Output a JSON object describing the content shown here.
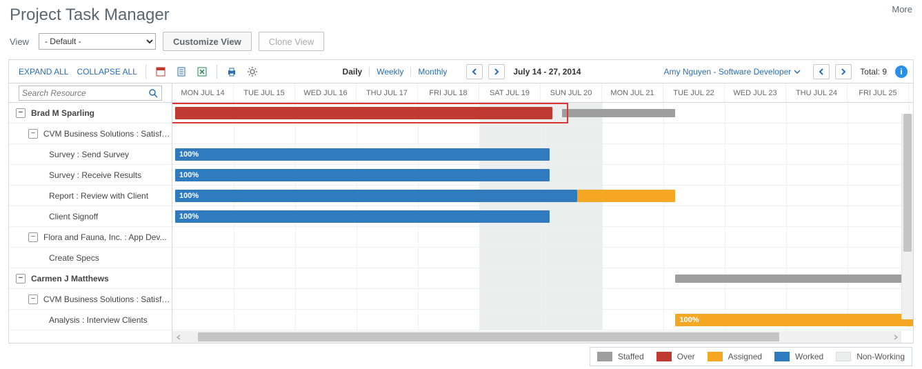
{
  "more_link": "More",
  "page_title": "Project Task Manager",
  "view_label": "View",
  "view_select_value": "- Default -",
  "customize_btn": "Customize View",
  "clone_btn": "Clone View",
  "expand_all": "EXPAND ALL",
  "collapse_all": "COLLAPSE ALL",
  "view_modes": {
    "daily": "Daily",
    "weekly": "Weekly",
    "monthly": "Monthly"
  },
  "date_range": "July 14 - 27, 2014",
  "user_dropdown": "Amy  Nguyen - Software Developer",
  "total_label": "Total:",
  "total_value": "9",
  "search_placeholder": "Search Resource",
  "timeline_headers": [
    "MON JUL 14",
    "TUE JUL 15",
    "WED JUL 16",
    "THU JUL 17",
    "FRI JUL 18",
    "SAT JUL 19",
    "SUN JUL 20",
    "MON JUL 21",
    "TUE JUL 22",
    "WED JUL 23",
    "THU JUL 24",
    "FRI JUL 25"
  ],
  "nonworking_cols": [
    5,
    6
  ],
  "tree": [
    {
      "level": 0,
      "expander": "−",
      "label": "Brad M Sparling"
    },
    {
      "level": 1,
      "expander": "−",
      "label": "CVM Business Solutions : Satisfa..."
    },
    {
      "level": 2,
      "label": "Survey : Send Survey"
    },
    {
      "level": 2,
      "label": "Survey : Receive Results"
    },
    {
      "level": 2,
      "label": "Report : Review with Client"
    },
    {
      "level": 2,
      "label": "Client Signoff"
    },
    {
      "level": 1,
      "expander": "−",
      "label": "Flora and Fauna, Inc. : App Dev..."
    },
    {
      "level": 2,
      "label": "Create Specs"
    },
    {
      "level": 0,
      "expander": "−",
      "label": "Carmen J Matthews"
    },
    {
      "level": 1,
      "expander": "−",
      "label": "CVM Business Solutions : Satisfa..."
    },
    {
      "level": 2,
      "label": "Analysis : Interview Clients"
    }
  ],
  "bars": [
    {
      "row": 0,
      "type": "over",
      "start": 0,
      "span": 6.15,
      "label": ""
    },
    {
      "row": 0,
      "type": "staffed",
      "start": 6.3,
      "span": 1.85,
      "label": ""
    },
    {
      "row": 2,
      "type": "worked",
      "start": 0,
      "span": 6.1,
      "label": "100%"
    },
    {
      "row": 3,
      "type": "worked",
      "start": 0,
      "span": 6.1,
      "label": "100%"
    },
    {
      "row": 4,
      "type": "worked",
      "start": 0,
      "span": 6.55,
      "label": "100%"
    },
    {
      "row": 4,
      "type": "assigned",
      "start": 6.55,
      "span": 1.6,
      "label": ""
    },
    {
      "row": 5,
      "type": "worked",
      "start": 0,
      "span": 6.1,
      "label": "100%"
    },
    {
      "row": 8,
      "type": "staffed",
      "start": 8.15,
      "span": 3.95,
      "label": ""
    },
    {
      "row": 10,
      "type": "assigned",
      "start": 8.15,
      "span": 4.0,
      "label": "100%"
    }
  ],
  "red_highlight": {
    "row": 0,
    "start": -0.05,
    "span": 6.5
  },
  "legend": {
    "staffed": "Staffed",
    "over": "Over",
    "assigned": "Assigned",
    "worked": "Worked",
    "nonworking": "Non-Working"
  },
  "colors": {
    "staffed": "#9e9e9e",
    "over": "#c13a32",
    "assigned": "#f5a623",
    "worked": "#307abf",
    "nonworking": "#eceeee"
  }
}
